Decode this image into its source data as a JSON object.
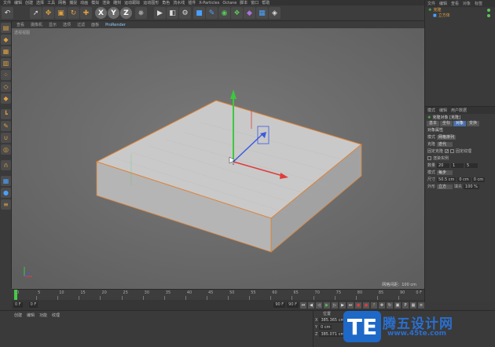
{
  "menu": [
    "文件",
    "编辑",
    "创建",
    "选择",
    "工具",
    "网格",
    "捕捉",
    "动画",
    "模拟",
    "渲染",
    "雕刻",
    "运动跟踪",
    "运动图形",
    "角色",
    "流水线",
    "插件",
    "X-Particles",
    "Octane",
    "脚本",
    "窗口",
    "帮助"
  ],
  "toolbar": {
    "axis_x": "X",
    "axis_y": "Y",
    "axis_z": "Z"
  },
  "viewport": {
    "menu": [
      "查看",
      "摄像机",
      "显示",
      "选项",
      "过滤",
      "面板",
      "ProRender"
    ],
    "label": "透视视图",
    "grid_info": "网格间距：100 cm"
  },
  "object_manager": {
    "menu": [
      "文件",
      "编辑",
      "查看",
      "对象",
      "标签"
    ],
    "items": [
      {
        "name": "克隆"
      },
      {
        "name": "立方体"
      }
    ]
  },
  "attributes": {
    "menu": [
      "模式",
      "编辑",
      "用户数据"
    ],
    "object_title": "克隆对象 [克隆]",
    "tabs": [
      "基本",
      "坐标",
      "对象",
      "变换"
    ],
    "active_tab": "对象",
    "section": "对象属性",
    "mode_label": "模式",
    "mode_value": "网格排列",
    "clone_label": "克隆",
    "clone_value": "迭代",
    "fix_clone_label": "固定克隆",
    "fix_clone_checked": "✓",
    "fix_texture_label": "固定纹理",
    "render_instance_label": "渲染实例",
    "count_label": "数量",
    "count_values": [
      "20",
      "1",
      "5"
    ],
    "mode2_label": "模式",
    "mode2_value": "每步",
    "size_label": "尺寸",
    "size_values": [
      "50.5 cm",
      "0 cm",
      "0 cm"
    ],
    "outline_label": "外形",
    "outline_value": "立方",
    "fill_label": "填充",
    "fill_value": "100 %"
  },
  "timeline": {
    "ticks": [
      "0",
      "5",
      "10",
      "15",
      "20",
      "25",
      "30",
      "35",
      "40",
      "45",
      "50",
      "55",
      "60",
      "65",
      "70",
      "75",
      "80",
      "85",
      "90"
    ],
    "end_label": "0 F"
  },
  "transport": {
    "start": "0 F",
    "current": "0 F",
    "end": "90 F",
    "max": "90 F"
  },
  "materials": {
    "menu": [
      "创建",
      "编辑",
      "功能",
      "纹理"
    ]
  },
  "coordinates": {
    "headers": [
      "位置",
      "尺寸"
    ],
    "rows": [
      {
        "axis": "X",
        "value": "385.365 cm"
      },
      {
        "axis": "Y",
        "value": "0 cm"
      },
      {
        "axis": "Z",
        "value": "385.071 cm"
      }
    ]
  },
  "watermark": {
    "logo": "TE",
    "title": "腾五设计网",
    "url": "www.45te.com"
  },
  "colors": {
    "accent": "#e0a040",
    "x_axis": "#e03c3c",
    "y_axis": "#3cc83c",
    "z_axis": "#3c5ae0",
    "selection": "#e08030"
  }
}
